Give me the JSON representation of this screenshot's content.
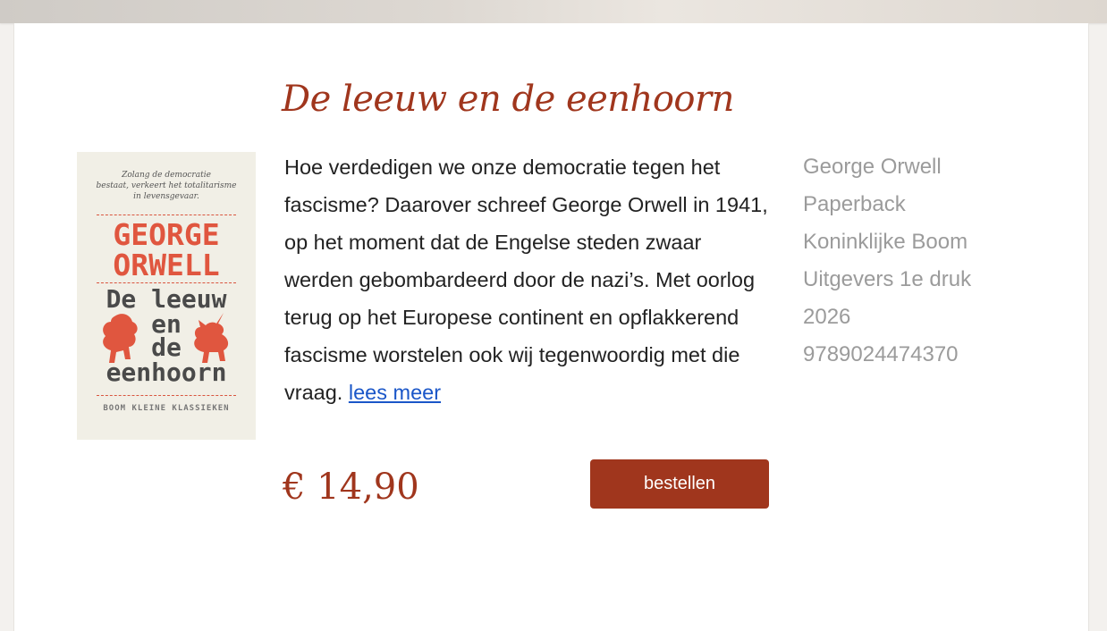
{
  "book": {
    "title": "De leeuw en de eenhoorn",
    "description": "Hoe verdedigen we onze democratie tegen het fascisme? Daarover schreef George Orwell in 1941, op het moment dat de Engelse steden zwaar werden gebombardeerd door de nazi’s. Met oorlog terug op het Europese continent en opflakkerend fascisme worstelen ook wij tegenwoordig met die vraag.",
    "read_more": "lees meer",
    "price": "€ 14,90",
    "order_label": "bestellen"
  },
  "meta": {
    "author": "George Orwell",
    "format": "Paperback",
    "publisher": "Koninklijke Boom Uitgevers 1e druk 2026",
    "isbn": "9789024474370"
  },
  "cover": {
    "tagline": [
      "Zolang de democratie",
      "bestaat, verkeert het totalitarisme",
      "in levensgevaar."
    ],
    "author_lines": [
      "GEORGE",
      "ORWELL"
    ],
    "title_lines": [
      "De leeuw",
      "en",
      "de",
      "eenhoorn"
    ],
    "series": "BOOM KLEINE KLASSIEKEN"
  },
  "colors": {
    "accent": "#a0361d",
    "link": "#1a56c8",
    "meta_text": "#9b9b9b",
    "cover_red": "#e0563f"
  }
}
